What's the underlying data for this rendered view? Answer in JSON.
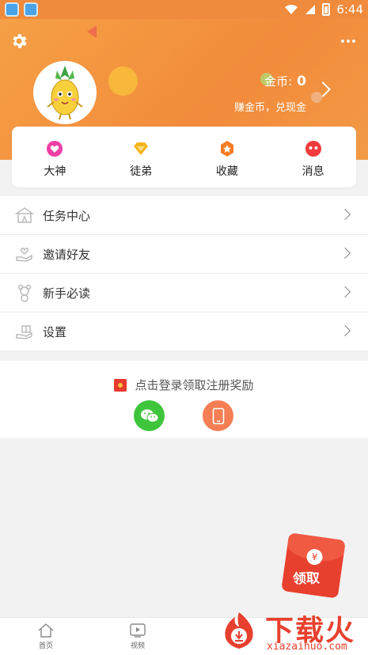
{
  "status_bar": {
    "time": "6:44"
  },
  "header": {
    "coins_label": "金币:",
    "coins_value": "0",
    "earn_text": "赚金币，兑现金"
  },
  "quick_bar": [
    {
      "label": "大神",
      "icon": "heart-icon",
      "color": "#ef3fa5"
    },
    {
      "label": "徒弟",
      "icon": "diamond-icon",
      "color": "#f4b51e"
    },
    {
      "label": "收藏",
      "icon": "star-icon",
      "color": "#f57c22"
    },
    {
      "label": "消息",
      "icon": "message-icon",
      "color": "#ef3b3b"
    }
  ],
  "menu": [
    {
      "label": "任务中心",
      "icon": "circus-tent-icon"
    },
    {
      "label": "邀请好友",
      "icon": "hand-heart-icon"
    },
    {
      "label": "新手必读",
      "icon": "teddy-bear-icon"
    },
    {
      "label": "设置",
      "icon": "gift-hand-icon"
    }
  ],
  "login": {
    "tip": "点击登录领取注册奖励",
    "wechat_icon": "wechat-icon",
    "phone_icon": "phone-icon"
  },
  "envelope": {
    "text": "领取",
    "coin": "¥"
  },
  "bottom_nav": {
    "home_label": "首页",
    "video_label": "视频"
  },
  "watermark": {
    "title": "下载火",
    "url": "xiazaihuo.com"
  },
  "colors": {
    "header_orange": "#f28b3b",
    "wechat_green": "#3fc53b",
    "phone_orange": "#f57e55",
    "envelope_red": "#e8402e"
  }
}
